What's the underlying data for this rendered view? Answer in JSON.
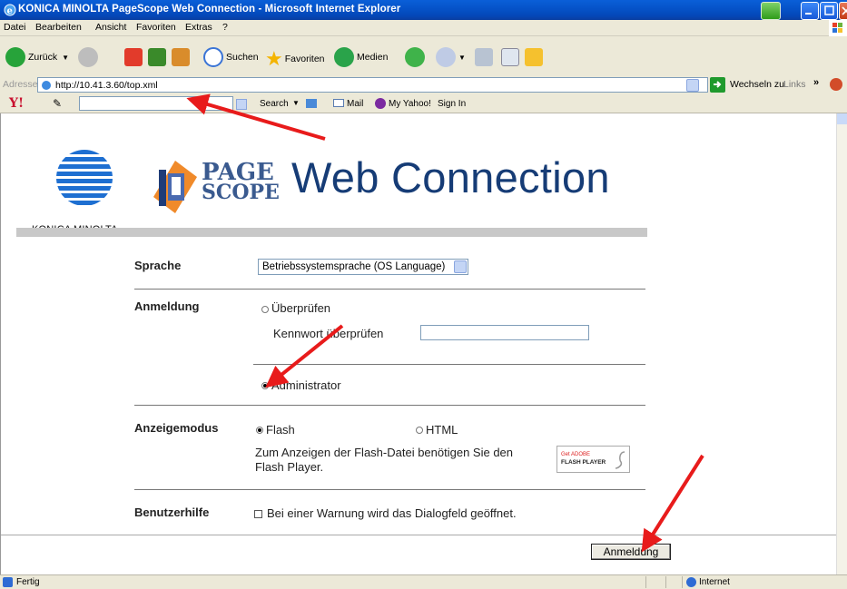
{
  "window": {
    "title": "KONICA MINOLTA PageScope Web Connection - Microsoft Internet Explorer"
  },
  "menu": [
    "Datei",
    "Bearbeiten",
    "Ansicht",
    "Favoriten",
    "Extras",
    "?"
  ],
  "toolbar": {
    "back_label": "Zurück",
    "search_label": "Suchen",
    "favorites_label": "Favoriten",
    "media_label": "Medien"
  },
  "address": {
    "label": "Adresse",
    "url": "http://10.41.3.60/top.xml",
    "go_label": "Wechseln zu",
    "links_label": "Links"
  },
  "yahoo": {
    "logo": "Y!",
    "search_label": "Search",
    "mail_label": "Mail",
    "myyahoo_label": "My Yahoo!",
    "signin_label": "Sign In"
  },
  "page": {
    "brand": "KONICA MINOLTA",
    "pagescope_line1": "PAGE",
    "pagescope_line2": "SCOPE",
    "title": "Web Connection",
    "language": {
      "label": "Sprache",
      "selected": "Betriebssystemsprache (OS Language)"
    },
    "login": {
      "label": "Anmeldung",
      "option_check": "Überprüfen",
      "password_label": "Kennwort überprüfen",
      "password_value": "",
      "option_admin": "Administrator",
      "selected": "Administrator"
    },
    "display_mode": {
      "label": "Anzeigemodus",
      "option_flash": "Flash",
      "option_html": "HTML",
      "selected": "Flash",
      "note_line1": "Zum Anzeigen der Flash-Datei benötigen Sie den",
      "note_line2": "Flash Player.",
      "badge_get": "Get ADOBE",
      "badge_player": "FLASH PLAYER"
    },
    "help": {
      "label": "Benutzerhilfe",
      "checkbox_text": "Bei einer Warnung wird das Dialogfeld geöffnet.",
      "checked": false
    },
    "login_button": "Anmeldung"
  },
  "status": {
    "text": "Fertig",
    "zone": "Internet"
  },
  "colors": {
    "titlebar": "#0552c8",
    "annotation_arrow": "#e81b1b",
    "brand_blue": "#163c76"
  }
}
